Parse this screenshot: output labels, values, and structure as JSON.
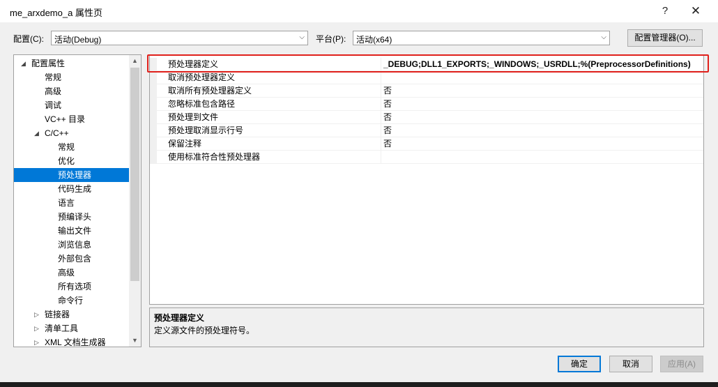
{
  "window": {
    "title": "me_arxdemo_a 属性页",
    "help_glyph": "?",
    "close_glyph": "✕"
  },
  "config_bar": {
    "config_label": "配置(C):",
    "config_value": "活动(Debug)",
    "platform_label": "平台(P):",
    "platform_value": "活动(x64)",
    "manager_button": "配置管理器(O)...",
    "dropdown_glyph": "⌵"
  },
  "tree": {
    "items": [
      {
        "label": "配置属性",
        "toggle": "◢"
      },
      {
        "label": "常规"
      },
      {
        "label": "高级"
      },
      {
        "label": "调试"
      },
      {
        "label": "VC++ 目录"
      },
      {
        "label": "C/C++",
        "toggle": "◢"
      },
      {
        "label": "常规"
      },
      {
        "label": "优化"
      },
      {
        "label": "预处理器"
      },
      {
        "label": "代码生成"
      },
      {
        "label": "语言"
      },
      {
        "label": "预编译头"
      },
      {
        "label": "输出文件"
      },
      {
        "label": "浏览信息"
      },
      {
        "label": "外部包含"
      },
      {
        "label": "高级"
      },
      {
        "label": "所有选项"
      },
      {
        "label": "命令行"
      },
      {
        "label": "链接器",
        "toggle": "▷"
      },
      {
        "label": "清单工具",
        "toggle": "▷"
      },
      {
        "label": "XML 文档生成器",
        "toggle": "▷"
      }
    ],
    "selected": "预处理器",
    "scroll_up_glyph": "▲",
    "scroll_down_glyph": "▼"
  },
  "properties": {
    "rows": [
      {
        "name": "预处理器定义",
        "value": "_DEBUG;DLL1_EXPORTS;_WINDOWS;_USRDLL;%(PreprocessorDefinitions)"
      },
      {
        "name": "取消预处理器定义",
        "value": ""
      },
      {
        "name": "取消所有预处理器定义",
        "value": "否"
      },
      {
        "name": "忽略标准包含路径",
        "value": "否"
      },
      {
        "name": "预处理到文件",
        "value": "否"
      },
      {
        "name": "预处理取消显示行号",
        "value": "否"
      },
      {
        "name": "保留注释",
        "value": "否"
      },
      {
        "name": "使用标准符合性预处理器",
        "value": ""
      }
    ]
  },
  "description": {
    "title": "预处理器定义",
    "text": "定义源文件的预处理符号。"
  },
  "buttons": {
    "ok": "确定",
    "cancel": "取消",
    "apply": "应用(A)"
  },
  "colors": {
    "selection": "#0078d7",
    "highlight": "#e0201b"
  }
}
